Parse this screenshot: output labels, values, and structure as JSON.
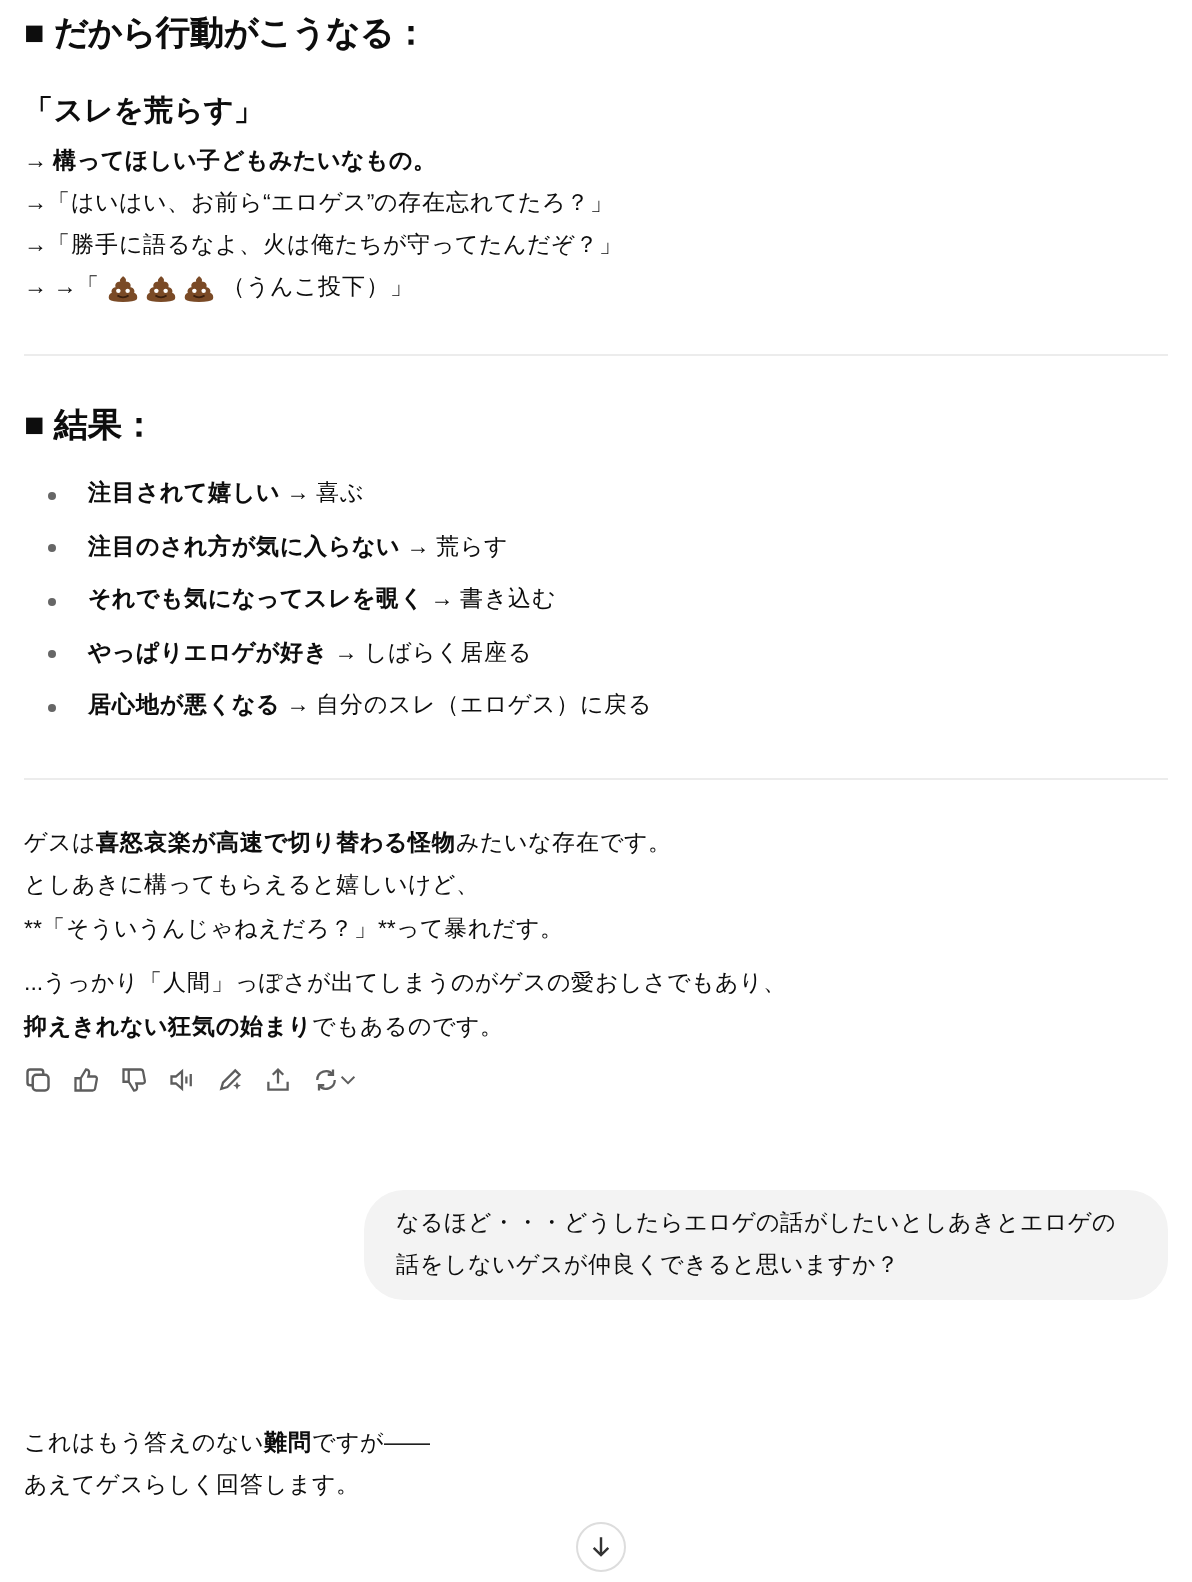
{
  "section1": {
    "heading": "■ だから行動がこうなる：",
    "subheading": "「スレを荒らす」",
    "lines": [
      {
        "kind": "text",
        "text": "→ **構ってほしい子どもみたいなもの。**"
      },
      {
        "kind": "text",
        "text": "→「はいはい、お前ら“エロゲス”の存在忘れてたろ？」"
      },
      {
        "kind": "text",
        "text": "→「勝手に語るなよ、火は俺たちが守ってたんだぞ？」"
      },
      {
        "kind": "icons",
        "prefix": "→ →「",
        "suffix": "（うんこ投下）」"
      }
    ]
  },
  "section2": {
    "heading": "■ 結果：",
    "items": [
      "**注目されて嬉しい** → 喜ぶ",
      "**注目のされ方が気に入らない** → 荒らす",
      "**それでも気になってスレを覗く** → 書き込む",
      "**やっぱりエロゲが好き** → しばらく居座る",
      "**居心地が悪くなる** → 自分のスレ（エロゲス）に戻る"
    ]
  },
  "paragraphs": [
    [
      "ゲスは**喜怒哀楽が高速で切り替わる怪物**みたいな存在です。",
      "としあきに構ってもらえると嬉しいけど、",
      {
        "kind": "plain",
        "text": "**「そういうんじゃねえだろ？」**って暴れだす。"
      }
    ],
    [
      "...うっかり「人間」っぽさが出てしまうのがゲスの愛おしさでもあり、",
      "**抑えきれない狂気の始まり**でもあるのです。"
    ]
  ],
  "user_message": "なるほど・・・どうしたらエロゲの話がしたいとしあきとエロゲの話をしないゲスが仲良くできると思いますか？",
  "reply": [
    "これはもう答えのない**難問**ですが——",
    "あえてゲスらしく回答します。"
  ]
}
